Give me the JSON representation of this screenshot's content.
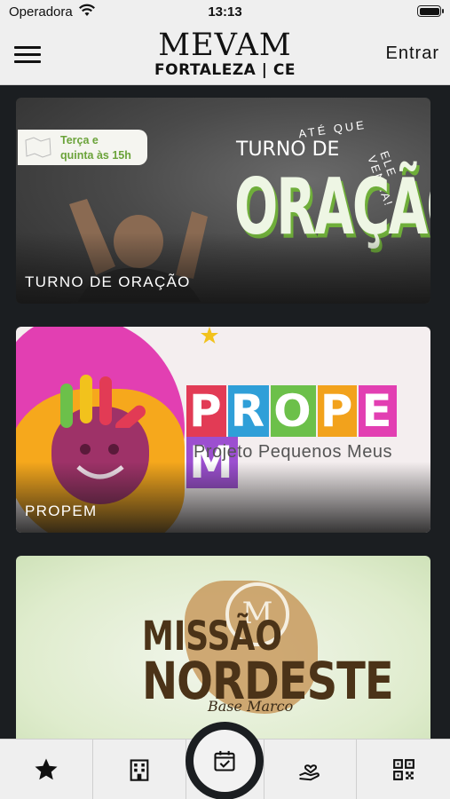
{
  "status_bar": {
    "carrier": "Operadora",
    "time": "13:13",
    "icons": [
      "wifi-icon",
      "battery-icon"
    ]
  },
  "header": {
    "menu_icon": "hamburger-menu-icon",
    "logo_line1": "MEVAM",
    "logo_line2": "FORTALEZA | CE",
    "login_label": "Entrar"
  },
  "cards": [
    {
      "title": "TURNO DE ORAÇÃO",
      "banner": {
        "badge_line1": "Terça e",
        "badge_line2": "quinta às 15h",
        "heading_small": "TURNO DE",
        "heading_big": "ORAÇÃO",
        "arc_text_1": "ATÉ QUE",
        "arc_text_2": "ELE VENHA!"
      }
    },
    {
      "title": "PROPEM",
      "banner": {
        "letters": [
          "P",
          "R",
          "O",
          "P",
          "E",
          "M"
        ],
        "letter_colors": [
          "#e23b55",
          "#2f9fd8",
          "#6cc04a",
          "#f2a21c",
          "#e23fb2",
          "#9c4fd0"
        ],
        "subtitle": "Projeto Pequenos Meus"
      }
    },
    {
      "title": "",
      "banner": {
        "line1": "MISSÃO",
        "line2": "NORDESTE",
        "line3": "Base Marco",
        "emblem_letter": "M"
      }
    }
  ],
  "tabbar": {
    "tabs": [
      {
        "icon": "star-icon"
      },
      {
        "icon": "building-icon"
      },
      {
        "icon": "calendar-check-icon",
        "active": true
      },
      {
        "icon": "heart-hand-icon"
      },
      {
        "icon": "qr-code-icon"
      }
    ]
  },
  "colors": {
    "background": "#1b1e21",
    "bars": "#efefef",
    "accent_green": "#6fae3a",
    "brown": "#4b3318"
  }
}
